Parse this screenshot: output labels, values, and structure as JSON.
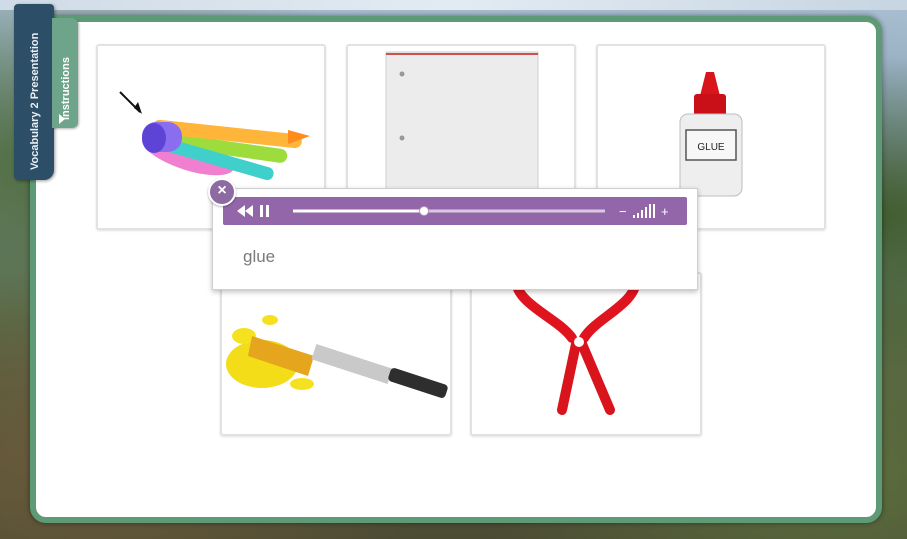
{
  "side_tab": {
    "title": "Vocabulary 2 Presentation"
  },
  "instructions_tab": {
    "label": "Instructions"
  },
  "cards": [
    {
      "name": "markers",
      "image": "highlighter-markers"
    },
    {
      "name": "notebook-paper",
      "image": "loose-leaf-paper"
    },
    {
      "name": "glue",
      "image": "glue-bottle",
      "label_text": "GLUE"
    },
    {
      "name": "paintbrush",
      "image": "paintbrush-yellow-paint"
    },
    {
      "name": "scissors",
      "image": "red-scissors"
    }
  ],
  "popup": {
    "word": "glue",
    "close_icon": "close-icon",
    "player": {
      "rewind_icon": "rewind-icon",
      "pause_icon": "pause-icon",
      "progress": 0.42,
      "volume_icon": "volume-bars-icon",
      "volume_down": "−",
      "volume_up": "+"
    }
  },
  "colors": {
    "panel_border": "#5f9a76",
    "side_tab": "#2d4e67",
    "player": "#9266a8",
    "close": "#8d6aa2"
  }
}
